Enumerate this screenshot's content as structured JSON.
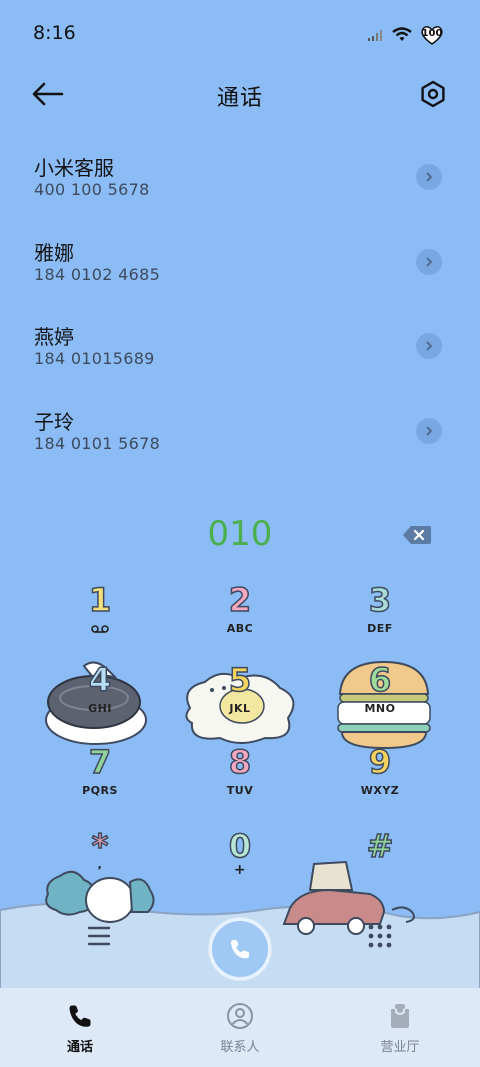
{
  "status_bar": {
    "time": "8:16",
    "battery": "100"
  },
  "header": {
    "title": "通话"
  },
  "contacts": [
    {
      "name": "小米客服",
      "number": "400 100 5678"
    },
    {
      "name": "雅娜",
      "number": "184 0102 4685"
    },
    {
      "name": "燕婷",
      "number": "184 01015689"
    },
    {
      "name": "子玲",
      "number": "184 0101 5678"
    }
  ],
  "dialed_number": "010",
  "keypad": [
    {
      "digit": "1",
      "letters": "",
      "color": "#f4e07a"
    },
    {
      "digit": "2",
      "letters": "ABC",
      "color": "#f6a8c0"
    },
    {
      "digit": "3",
      "letters": "DEF",
      "color": "#a9dcd8"
    },
    {
      "digit": "4",
      "letters": "GHI",
      "color": "#b6dcf2"
    },
    {
      "digit": "5",
      "letters": "JKL",
      "color": "#f4d35e"
    },
    {
      "digit": "6",
      "letters": "MNO",
      "color": "#9fdc9a"
    },
    {
      "digit": "7",
      "letters": "PQRS",
      "color": "#8fd39a"
    },
    {
      "digit": "8",
      "letters": "TUV",
      "color": "#f6a8c0"
    },
    {
      "digit": "9",
      "letters": "WXYZ",
      "color": "#f4d35e"
    },
    {
      "digit": "*",
      "letters": ",",
      "color": "#f6a8c0"
    },
    {
      "digit": "0",
      "letters": "+",
      "color": "#b6e6d6"
    },
    {
      "digit": "#",
      "letters": "",
      "color": "#8fd39a"
    }
  ],
  "tabs": [
    {
      "label": "通话",
      "icon": "phone-icon",
      "active": true
    },
    {
      "label": "联系人",
      "icon": "person-icon",
      "active": false
    },
    {
      "label": "营业厅",
      "icon": "bag-icon",
      "active": false
    }
  ],
  "colors": {
    "background": "#8bbcf6",
    "dialed": "#4bb04b",
    "tab_bar": "#dde9f7"
  }
}
